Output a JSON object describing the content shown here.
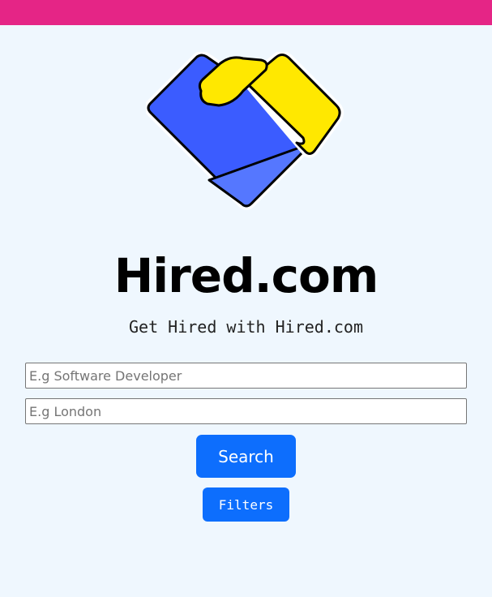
{
  "header": {
    "bar_color": "#e52586"
  },
  "logo": {
    "icon": "handshake-heart-logo",
    "colors": {
      "blue": "#3b5cff",
      "light_blue": "#5577ff",
      "yellow": "#ffe800"
    }
  },
  "brand": {
    "title": "Hired.com",
    "tagline": "Get Hired with Hired.com"
  },
  "search": {
    "job_placeholder": "E.g Software Developer",
    "location_placeholder": "E.g London",
    "search_label": "Search",
    "filters_label": "Filters"
  },
  "theme": {
    "background": "#eff7fe",
    "button": "#0d6efd"
  }
}
